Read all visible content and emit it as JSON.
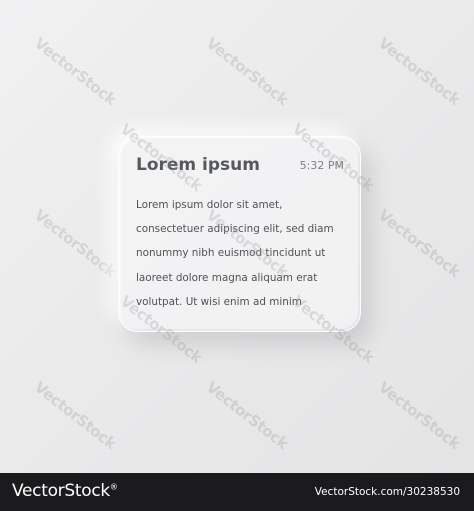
{
  "card": {
    "title": "Lorem ipsum",
    "time": "5:32 PM",
    "body_lines": [
      "Lorem ipsum dolor sit amet,",
      "consectetuer adipiscing elit, sed diam",
      "nonummy nibh euismod tincidunt ut",
      "laoreet dolore magna aliquam erat",
      "volutpat. Ut wisi enim ad minim"
    ]
  },
  "watermark": {
    "text": "VectorStock"
  },
  "footer": {
    "logo": "VectorStock",
    "logo_mark": "®",
    "url": "VectorStock.com/30238530"
  },
  "colors": {
    "background": "#ececed",
    "card_text": "#55595d",
    "footer_bg": "#1b1b1e"
  }
}
